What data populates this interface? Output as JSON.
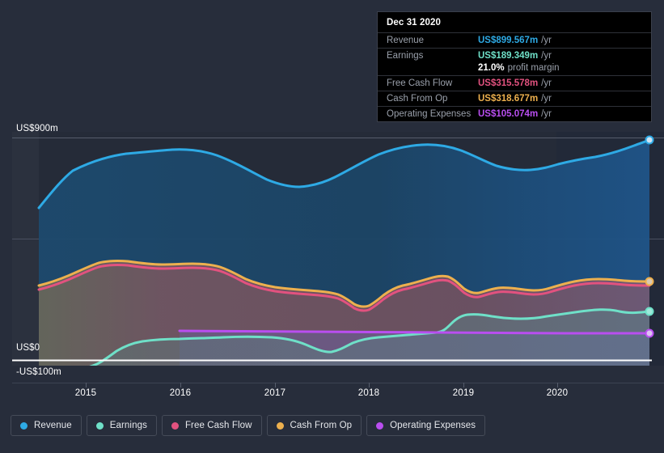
{
  "chart_data": {
    "type": "area",
    "title": "",
    "xlabel": "",
    "ylabel": "",
    "grid": true,
    "legend_position": "bottom",
    "xlim": [
      "2014-07",
      "2021-03"
    ],
    "ylim": [
      -150,
      900
    ],
    "y_ticks": [
      {
        "value": 900,
        "label": "US$900m"
      },
      {
        "value": 450,
        "label": ""
      },
      {
        "value": 0,
        "label": "US$0"
      },
      {
        "value": -100,
        "label": "-US$100m"
      }
    ],
    "x_ticks": [
      "2015",
      "2016",
      "2017",
      "2018",
      "2019",
      "2020"
    ],
    "currency": "US$",
    "units": "m",
    "forecast_split_label": "",
    "series": [
      {
        "name": "Revenue",
        "color": "#2eaae5",
        "fill": "#1d4a6e",
        "values": [
          610,
          668,
          702,
          712,
          718,
          700,
          668,
          640,
          628,
          645,
          672,
          700,
          726,
          740,
          736,
          716,
          692,
          678,
          672,
          685,
          700,
          712,
          716,
          726,
          760,
          800,
          845,
          899.567
        ]
      },
      {
        "name": "Earnings",
        "color": "#6fe0c8",
        "fill": "#4a6a72",
        "values": [
          -148,
          -132,
          -96,
          -40,
          -8,
          4,
          8,
          10,
          12,
          14,
          16,
          20,
          10,
          -18,
          -38,
          -30,
          -14,
          2,
          18,
          64,
          74,
          76,
          82,
          92,
          108,
          128,
          156,
          189.349
        ]
      },
      {
        "name": "Free Cash Flow",
        "color": "#e2527f",
        "fill": "#7a4a5c",
        "values": [
          292,
          318,
          354,
          360,
          356,
          354,
          352,
          350,
          348,
          310,
          296,
          288,
          278,
          268,
          276,
          300,
          288,
          268,
          290,
          322,
          288,
          282,
          280,
          292,
          312,
          316,
          312,
          315.578
        ]
      },
      {
        "name": "Cash From Op",
        "color": "#edb04e",
        "fill": "#7a6a52",
        "values": [
          300,
          326,
          362,
          368,
          364,
          362,
          360,
          358,
          356,
          318,
          304,
          296,
          286,
          276,
          284,
          308,
          296,
          276,
          298,
          330,
          296,
          290,
          288,
          300,
          320,
          324,
          320,
          318.677
        ]
      },
      {
        "name": "Operating Expenses",
        "color": "#b94ef0",
        "fill": "#6a4e86",
        "start_index": 7,
        "values": [
          null,
          null,
          null,
          null,
          null,
          null,
          null,
          118,
          117,
          117,
          116,
          116,
          115,
          115,
          114,
          114,
          113,
          112,
          112,
          111,
          110,
          110,
          109,
          108,
          107,
          106,
          106,
          105.074
        ]
      }
    ]
  },
  "tooltip": {
    "date": "Dec 31 2020",
    "rows": [
      {
        "name": "Revenue",
        "value": "US$899.567m",
        "unit": "/yr",
        "color": "#2eaae5"
      },
      {
        "name": "Earnings",
        "value": "US$189.349m",
        "unit": "/yr",
        "color": "#6fe0c8"
      },
      {
        "name": "",
        "value": "21.0%",
        "unit": "profit margin",
        "color": "#ffffff"
      },
      {
        "name": "Free Cash Flow",
        "value": "US$315.578m",
        "unit": "/yr",
        "color": "#e2527f"
      },
      {
        "name": "Cash From Op",
        "value": "US$318.677m",
        "unit": "/yr",
        "color": "#edb04e"
      },
      {
        "name": "Operating Expenses",
        "value": "US$105.074m",
        "unit": "/yr",
        "color": "#b94ef0"
      }
    ]
  },
  "axis": {
    "y_top": "US$900m",
    "y_zero": "US$0",
    "y_negative": "-US$100m",
    "x_ticks": [
      "2015",
      "2016",
      "2017",
      "2018",
      "2019",
      "2020"
    ]
  },
  "legend": {
    "items": [
      {
        "label": "Revenue",
        "color": "#2eaae5"
      },
      {
        "label": "Earnings",
        "color": "#6fe0c8"
      },
      {
        "label": "Free Cash Flow",
        "color": "#e2527f"
      },
      {
        "label": "Cash From Op",
        "color": "#edb04e"
      },
      {
        "label": "Operating Expenses",
        "color": "#b94ef0"
      }
    ]
  },
  "colors": {
    "page_background": "#272d3b",
    "plot_background": "#252b38",
    "plot_background_forecast": "#1f2531",
    "zero_line": "#ffffff",
    "grid_line": "#555c6b"
  }
}
